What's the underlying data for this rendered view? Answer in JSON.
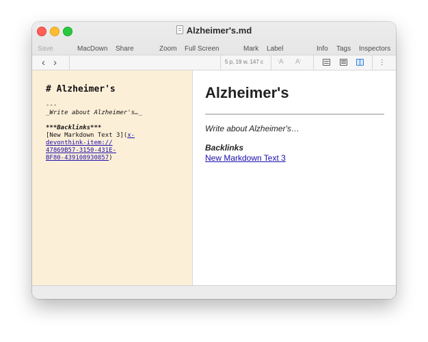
{
  "window": {
    "title": "Alzheimer's.md",
    "title_icon": "document-icon",
    "traffic_lights": {
      "close": "#ff5f57",
      "minimize": "#febc2e",
      "maximize": "#28c840"
    }
  },
  "toolbar": {
    "save": "Save",
    "macdown": "MacDown",
    "share": "Share",
    "zoom": "Zoom",
    "full_screen": "Full Screen",
    "mark": "Mark",
    "label": "Label",
    "info": "Info",
    "tags": "Tags",
    "inspectors": "Inspectors"
  },
  "navbar": {
    "back_icon": "chevron-left-icon",
    "forward_icon": "chevron-right-icon",
    "stats": "5 p, 19 w, 147 c",
    "font_smaller": "A",
    "font_larger": "A",
    "view_modes": [
      "document-view-icon",
      "text-view-icon",
      "split-view-icon"
    ],
    "active_view": "split-view-icon",
    "inspector_icon": "inspector-sliders-icon"
  },
  "editor": {
    "background": "#fcefd8",
    "heading": "# Alzheimer's",
    "rule": "---",
    "italic_line": "_Write about Alzheimer's…_",
    "backlinks_line": "***Backlinks***",
    "link_text": "[New Markdown Text 3](",
    "link_url_1": "x-",
    "link_url_2": "devonthink-item://",
    "link_url_3": "47869B57-3150-431E-",
    "link_url_4": "BF80-439108930857",
    "link_close": ")"
  },
  "preview": {
    "heading": "Alzheimer's",
    "paragraph": "Write about Alzheimer's…",
    "backlinks": "Backlinks",
    "link": "New Markdown Text 3",
    "link_color": "#1a0dab"
  }
}
